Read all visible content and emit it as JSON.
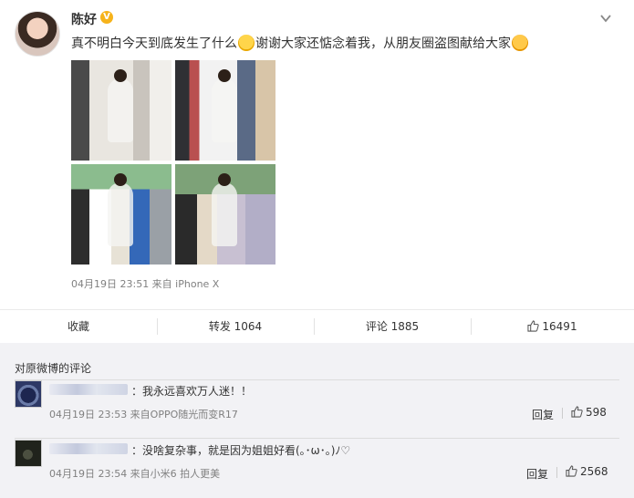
{
  "post": {
    "username": "陈好",
    "verified_badge": "V",
    "avatar_icon": "user-avatar",
    "text_part1": "真不明白今天到底发生了什么",
    "text_part2": "谢谢大家还惦念着我，从朋友圈盗图献给大家",
    "meta": "04月19日 23:51 来自 iPhone X",
    "photos": [
      "photo-1",
      "photo-2",
      "photo-3",
      "photo-4"
    ]
  },
  "actions": {
    "favorite": "收藏",
    "repost": "转发 1064",
    "comment": "评论 1885",
    "like_count": "16491"
  },
  "comments": {
    "title": "对原微博的评论",
    "items": [
      {
        "text": "：我永远喜欢万人迷！！",
        "meta": "04月19日 23:53 来自OPPO随光而变R17",
        "reply": "回复",
        "likes": "598"
      },
      {
        "text": "：没啥复杂事，就是因为姐姐好看(｡･ω･｡)ﾉ♡",
        "meta": "04月19日 23:54 来自小米6 拍人更美",
        "reply": "回复",
        "likes": "2568"
      }
    ]
  },
  "colors": {
    "accent": "#f6b31b",
    "meta_gray": "#808080",
    "comment_bg": "#f2f2f5"
  }
}
